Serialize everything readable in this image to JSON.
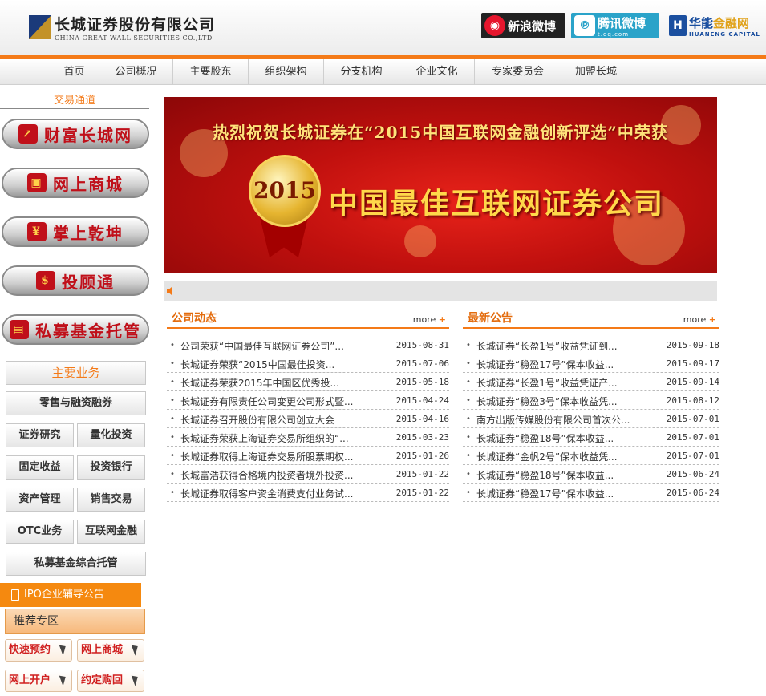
{
  "header": {
    "logo_cn": "长城证券股份有限公司",
    "logo_en": "CHINA GREAT WALL SECURITIES CO.,LTD",
    "links": [
      {
        "label": "新浪微博",
        "icon": "sina-weibo-icon"
      },
      {
        "label": "腾讯微博",
        "sub": "t.qq.com",
        "icon": "tencent-weibo-icon"
      },
      {
        "label_a": "华能",
        "label_b": "金融网",
        "sub": "HUANENG CAPITAL",
        "icon": "huaneng-icon"
      }
    ]
  },
  "nav": [
    "首页",
    "公司概况",
    "主要股东",
    "组织架构",
    "分支机构",
    "企业文化",
    "专家委员会",
    "加盟长城"
  ],
  "sidebar": {
    "trade_title": "交易通道",
    "trade_buttons": [
      "财富长城网",
      "网上商城",
      "掌上乾坤",
      "投顾通",
      "私募基金托管"
    ],
    "biz_title": "主要业务",
    "biz_buttons": [
      "零售与融资融券",
      "证券研究",
      "量化投资",
      "固定收益",
      "投资银行",
      "资产管理",
      "销售交易",
      "OTC业务",
      "互联网金融",
      "私募基金综合托管"
    ],
    "ipo": "IPO企业辅导公告",
    "rec_title": "推荐专区",
    "rec_buttons": [
      "快速预约",
      "网上商城",
      "网上开户",
      "约定购回"
    ]
  },
  "banner": {
    "top_text": "热烈祝贺长城证券在“2015中国互联网金融创新评选”中荣获",
    "medal": "2015",
    "main_text": "中国最佳互联网证券公司"
  },
  "news": {
    "title": "公司动态",
    "more": "more",
    "items": [
      {
        "t": "公司荣获“中国最佳互联网证券公司”...",
        "d": "2015-08-31"
      },
      {
        "t": "长城证券荣获“2015中国最佳投资...",
        "d": "2015-07-06"
      },
      {
        "t": "长城证券荣获2015年中国区优秀投...",
        "d": "2015-05-18"
      },
      {
        "t": "长城证券有限责任公司变更公司形式暨...",
        "d": "2015-04-24"
      },
      {
        "t": "长城证券召开股份有限公司创立大会",
        "d": "2015-04-16"
      },
      {
        "t": "长城证券荣获上海证券交易所组织的“...",
        "d": "2015-03-23"
      },
      {
        "t": "长城证券取得上海证券交易所股票期权...",
        "d": "2015-01-26"
      },
      {
        "t": "长城富浩获得合格境内投资者境外投资...",
        "d": "2015-01-22"
      },
      {
        "t": "长城证券取得客户资金消费支付业务试...",
        "d": "2015-01-22"
      }
    ]
  },
  "notices": {
    "title": "最新公告",
    "more": "more",
    "items": [
      {
        "t": "长城证券“长盈1号”收益凭证到...",
        "d": "2015-09-18"
      },
      {
        "t": "长城证券“稳盈17号”保本收益...",
        "d": "2015-09-17"
      },
      {
        "t": "长城证券“长盈1号”收益凭证产...",
        "d": "2015-09-14"
      },
      {
        "t": "长城证券“稳盈3号”保本收益凭...",
        "d": "2015-08-12"
      },
      {
        "t": "南方出版传媒股份有限公司首次公...",
        "d": "2015-07-01"
      },
      {
        "t": "长城证券“稳盈18号”保本收益...",
        "d": "2015-07-01"
      },
      {
        "t": "长城证券“金帆2号”保本收益凭...",
        "d": "2015-07-01"
      },
      {
        "t": "长城证券“稳盈18号”保本收益...",
        "d": "2015-06-24"
      },
      {
        "t": "长城证券“稳盈17号”保本收益...",
        "d": "2015-06-24"
      }
    ]
  }
}
